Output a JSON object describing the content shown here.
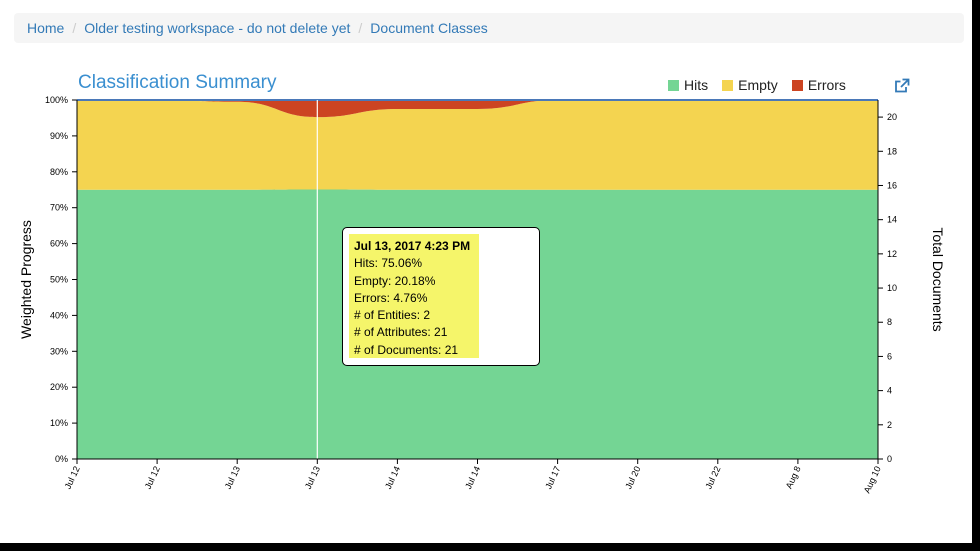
{
  "breadcrumb": {
    "items": [
      "Home",
      "Older testing workspace - do not delete yet",
      "Document Classes"
    ]
  },
  "chart_title": "Classification Summary",
  "legend": [
    {
      "label": "Hits",
      "color": "#74d594"
    },
    {
      "label": "Empty",
      "color": "#f4d450"
    },
    {
      "label": "Errors",
      "color": "#cc4422"
    }
  ],
  "tooltip": {
    "title": "Jul 13, 2017 4:23 PM",
    "lines": [
      "Hits: 75.06%",
      "Empty: 20.18%",
      "Errors: 4.76%",
      "# of Entities: 2",
      "# of Attributes: 21",
      "# of Documents: 21"
    ]
  },
  "chart_data": {
    "type": "area",
    "stacked": true,
    "x": [
      "Jul 12",
      "Jul 12",
      "Jul 13",
      "Jul 13",
      "Jul 14",
      "Jul 14",
      "Jul 17",
      "Jul 20",
      "Jul 22",
      "Aug 8",
      "Aug 10"
    ],
    "series": [
      {
        "name": "Hits",
        "values": [
          75,
          75,
          75,
          75.06,
          75,
          75,
          75,
          75,
          75,
          75,
          75
        ]
      },
      {
        "name": "Empty",
        "values": [
          25,
          25,
          24.5,
          20.18,
          22.5,
          22.5,
          25,
          25,
          25,
          25,
          25
        ]
      },
      {
        "name": "Errors",
        "values": [
          0,
          0,
          0.5,
          4.76,
          2.5,
          2.5,
          0,
          0,
          0,
          0,
          0
        ]
      }
    ],
    "y_left": {
      "label": "Weighted Progress",
      "ticks": [
        "0%",
        "10%",
        "20%",
        "30%",
        "40%",
        "50%",
        "60%",
        "70%",
        "80%",
        "90%",
        "100%"
      ],
      "range": [
        0,
        100
      ]
    },
    "y_right": {
      "label": "Total Documents",
      "ticks": [
        0,
        2,
        4,
        6,
        8,
        10,
        12,
        14,
        16,
        18,
        20
      ],
      "range": [
        0,
        21
      ]
    },
    "documents_line": [
      21,
      21,
      21,
      21,
      21,
      21,
      21,
      21,
      21,
      21,
      21
    ],
    "highlight_index": 3,
    "grid": false
  }
}
